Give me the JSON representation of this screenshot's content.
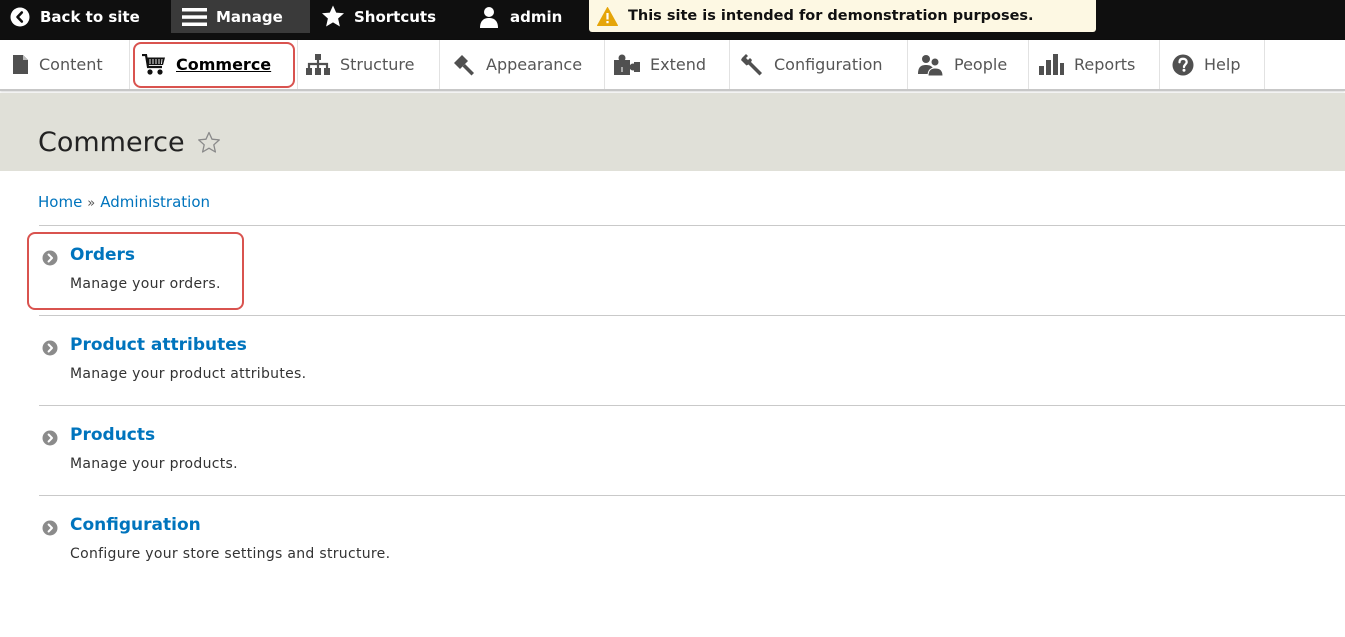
{
  "toolbar": {
    "back_label": "Back to site",
    "manage_label": "Manage",
    "shortcuts_label": "Shortcuts",
    "user_label": "admin",
    "demo_notice": "This site is intended for demonstration purposes."
  },
  "tray": {
    "items": [
      {
        "label": "Content",
        "icon": "file-icon"
      },
      {
        "label": "Commerce",
        "icon": "shopping-cart-icon",
        "active": true
      },
      {
        "label": "Structure",
        "icon": "sitemap-icon"
      },
      {
        "label": "Appearance",
        "icon": "paintbrush-icon"
      },
      {
        "label": "Extend",
        "icon": "puzzle-icon"
      },
      {
        "label": "Configuration",
        "icon": "wrench-icon"
      },
      {
        "label": "People",
        "icon": "people-icon"
      },
      {
        "label": "Reports",
        "icon": "bar-chart-icon"
      },
      {
        "label": "Help",
        "icon": "help-icon"
      }
    ]
  },
  "page": {
    "title": "Commerce"
  },
  "breadcrumb": {
    "items": [
      "Home",
      "Administration"
    ],
    "separator": "»"
  },
  "admin_list": [
    {
      "title": "Orders",
      "description": "Manage your orders."
    },
    {
      "title": "Product attributes",
      "description": "Manage your product attributes."
    },
    {
      "title": "Products",
      "description": "Manage your products."
    },
    {
      "title": "Configuration",
      "description": "Configure your store settings and structure."
    }
  ],
  "colors": {
    "toolbar_bg": "#0f0f0f",
    "link": "#0074bd",
    "highlight": "#d9534f",
    "header_bg": "#e0e0d8",
    "notice_bg": "#fdf8e3"
  }
}
